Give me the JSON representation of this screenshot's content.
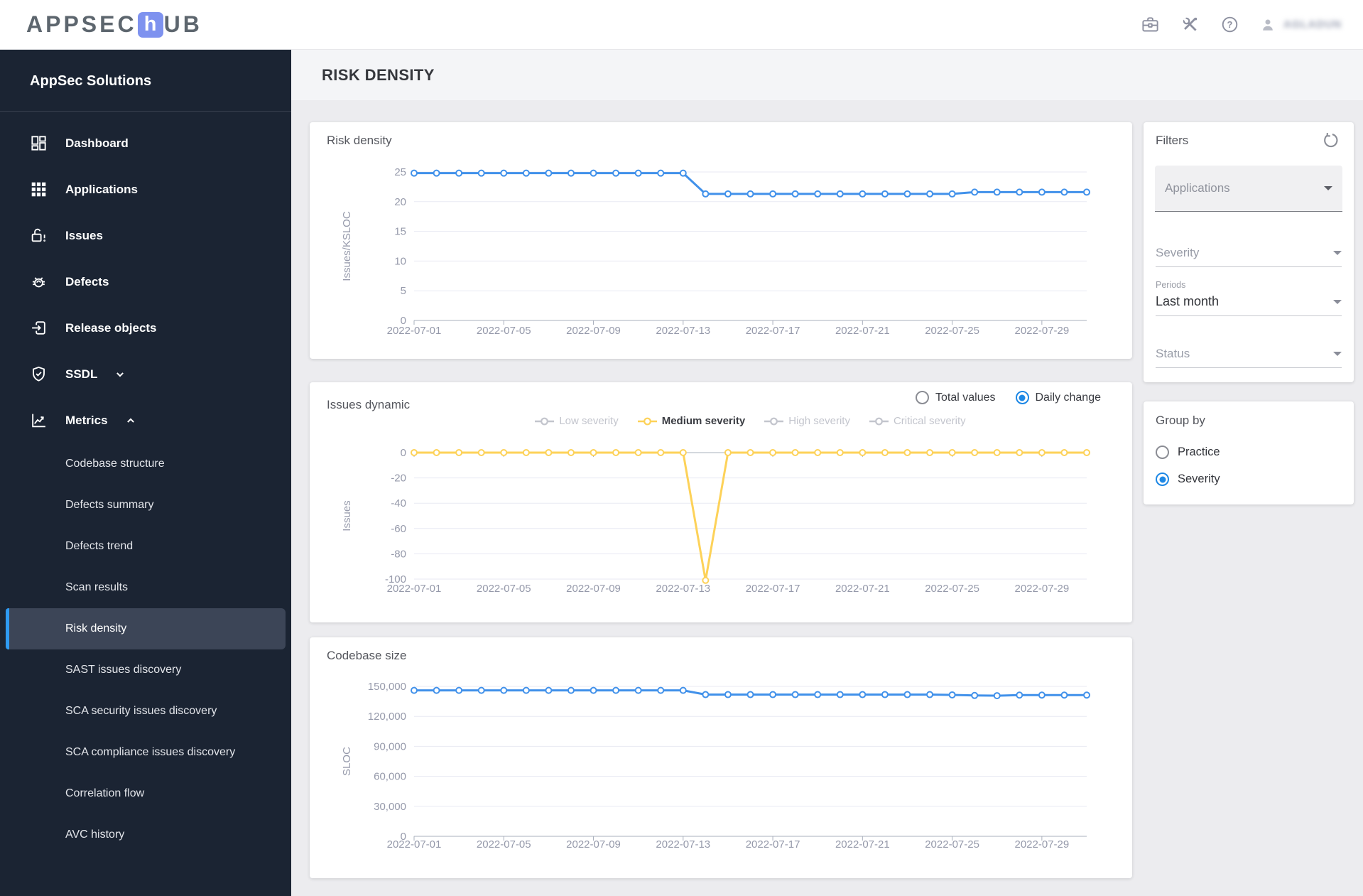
{
  "header": {
    "logo_pre": "APPSEC",
    "logo_h": "h",
    "logo_post": "UB",
    "icons": [
      "briefcase-icon",
      "tools-icon",
      "help-icon",
      "user-icon"
    ],
    "username": "AGLADUN"
  },
  "sidebar": {
    "title": "AppSec Solutions",
    "items": [
      {
        "label": "Dashboard",
        "icon": "dashboard-icon"
      },
      {
        "label": "Applications",
        "icon": "apps-grid-icon"
      },
      {
        "label": "Issues",
        "icon": "unlock-alert-icon"
      },
      {
        "label": "Defects",
        "icon": "bug-icon"
      },
      {
        "label": "Release objects",
        "icon": "release-box-icon"
      },
      {
        "label": "SSDL",
        "icon": "shield-check-icon",
        "chevron": "down",
        "expanded": false
      },
      {
        "label": "Metrics",
        "icon": "metrics-chart-icon",
        "chevron": "up",
        "expanded": true
      }
    ],
    "metrics_subitems": [
      {
        "label": "Codebase structure",
        "selected": false
      },
      {
        "label": "Defects summary",
        "selected": false
      },
      {
        "label": "Defects trend",
        "selected": false
      },
      {
        "label": "Scan results",
        "selected": false
      },
      {
        "label": "Risk density",
        "selected": true
      },
      {
        "label": "SAST issues discovery",
        "selected": false
      },
      {
        "label": "SCA security issues discovery",
        "selected": false
      },
      {
        "label": "SCA compliance issues discovery",
        "selected": false
      },
      {
        "label": "Correlation flow",
        "selected": false
      },
      {
        "label": "AVC history",
        "selected": false
      }
    ]
  },
  "page": {
    "title": "RISK DENSITY"
  },
  "filters": {
    "title": "Filters",
    "reset_icon": "reset-icon",
    "applications": {
      "label": "Applications"
    },
    "severity": {
      "label": "Severity"
    },
    "periods": {
      "caption": "Periods",
      "value": "Last month"
    },
    "status": {
      "label": "Status"
    }
  },
  "group_by": {
    "title": "Group by",
    "options": [
      {
        "label": "Practice",
        "selected": false
      },
      {
        "label": "Severity",
        "selected": true
      }
    ]
  },
  "chart_data": [
    {
      "type": "line",
      "title": "Risk density",
      "ylabel": "Issues/KSLOC",
      "ylim": [
        0,
        25
      ],
      "yticks": [
        0,
        5,
        10,
        15,
        20,
        25
      ],
      "grid": true,
      "marker_style": "hollow-circle",
      "x": [
        "2022-07-01",
        "2022-07-02",
        "2022-07-03",
        "2022-07-04",
        "2022-07-05",
        "2022-07-06",
        "2022-07-07",
        "2022-07-08",
        "2022-07-09",
        "2022-07-10",
        "2022-07-11",
        "2022-07-12",
        "2022-07-13",
        "2022-07-14",
        "2022-07-15",
        "2022-07-16",
        "2022-07-17",
        "2022-07-18",
        "2022-07-19",
        "2022-07-20",
        "2022-07-21",
        "2022-07-22",
        "2022-07-23",
        "2022-07-24",
        "2022-07-25",
        "2022-07-26",
        "2022-07-27",
        "2022-07-28",
        "2022-07-29",
        "2022-07-30",
        "2022-07-31"
      ],
      "x_shown_tick_indices": [
        0,
        4,
        8,
        12,
        16,
        20,
        24,
        28
      ],
      "series": [
        {
          "name": "Risk density",
          "color": "#4191ea",
          "values": [
            24.8,
            24.8,
            24.8,
            24.8,
            24.8,
            24.8,
            24.8,
            24.8,
            24.8,
            24.8,
            24.8,
            24.8,
            24.8,
            21.3,
            21.3,
            21.3,
            21.3,
            21.3,
            21.3,
            21.3,
            21.3,
            21.3,
            21.3,
            21.3,
            21.3,
            21.6,
            21.6,
            21.6,
            21.6,
            21.6,
            21.6
          ]
        }
      ]
    },
    {
      "type": "line",
      "title": "Issues dynamic",
      "ylabel": "Issues",
      "ylim": [
        -100,
        0
      ],
      "yticks": [
        0,
        -20,
        -40,
        -60,
        -80,
        -100
      ],
      "grid": true,
      "marker_style": "hollow-circle",
      "mode_options": [
        {
          "label": "Total values",
          "selected": false
        },
        {
          "label": "Daily change",
          "selected": true
        }
      ],
      "legend": [
        {
          "label": "Low severity",
          "active": false,
          "color": "#c3c5cd"
        },
        {
          "label": "Medium severity",
          "active": true,
          "color": "#fdd259"
        },
        {
          "label": "High severity",
          "active": false,
          "color": "#c3c5cd"
        },
        {
          "label": "Critical severity",
          "active": false,
          "color": "#c3c5cd"
        }
      ],
      "x": [
        "2022-07-01",
        "2022-07-02",
        "2022-07-03",
        "2022-07-04",
        "2022-07-05",
        "2022-07-06",
        "2022-07-07",
        "2022-07-08",
        "2022-07-09",
        "2022-07-10",
        "2022-07-11",
        "2022-07-12",
        "2022-07-13",
        "2022-07-14",
        "2022-07-15",
        "2022-07-16",
        "2022-07-17",
        "2022-07-18",
        "2022-07-19",
        "2022-07-20",
        "2022-07-21",
        "2022-07-22",
        "2022-07-23",
        "2022-07-24",
        "2022-07-25",
        "2022-07-26",
        "2022-07-27",
        "2022-07-28",
        "2022-07-29",
        "2022-07-30",
        "2022-07-31"
      ],
      "x_shown_tick_indices": [
        0,
        4,
        8,
        12,
        16,
        20,
        24,
        28
      ],
      "series": [
        {
          "name": "Medium severity",
          "color": "#fdd259",
          "values": [
            0,
            0,
            0,
            0,
            0,
            0,
            0,
            0,
            0,
            0,
            0,
            0,
            0,
            -101,
            0,
            0,
            0,
            0,
            0,
            0,
            0,
            0,
            0,
            0,
            0,
            0,
            0,
            0,
            0,
            0,
            0
          ]
        }
      ]
    },
    {
      "type": "line",
      "title": "Codebase size",
      "ylabel": "SLOC",
      "ylim": [
        0,
        150000
      ],
      "yticks": [
        0,
        30000,
        60000,
        90000,
        120000,
        150000
      ],
      "grid": true,
      "marker_style": "hollow-circle",
      "x": [
        "2022-07-01",
        "2022-07-02",
        "2022-07-03",
        "2022-07-04",
        "2022-07-05",
        "2022-07-06",
        "2022-07-07",
        "2022-07-08",
        "2022-07-09",
        "2022-07-10",
        "2022-07-11",
        "2022-07-12",
        "2022-07-13",
        "2022-07-14",
        "2022-07-15",
        "2022-07-16",
        "2022-07-17",
        "2022-07-18",
        "2022-07-19",
        "2022-07-20",
        "2022-07-21",
        "2022-07-22",
        "2022-07-23",
        "2022-07-24",
        "2022-07-25",
        "2022-07-26",
        "2022-07-27",
        "2022-07-28",
        "2022-07-29",
        "2022-07-30",
        "2022-07-31"
      ],
      "x_shown_tick_indices": [
        0,
        4,
        8,
        12,
        16,
        20,
        24,
        28
      ],
      "series": [
        {
          "name": "SLOC",
          "color": "#4191ea",
          "values": [
            146000,
            146000,
            146000,
            146000,
            146000,
            146000,
            146000,
            146000,
            146000,
            146000,
            146000,
            146000,
            146000,
            141800,
            141800,
            141800,
            141800,
            141800,
            141800,
            141800,
            141800,
            141800,
            141800,
            141800,
            141500,
            140900,
            140700,
            141300,
            141300,
            141300,
            141300
          ]
        }
      ]
    }
  ]
}
